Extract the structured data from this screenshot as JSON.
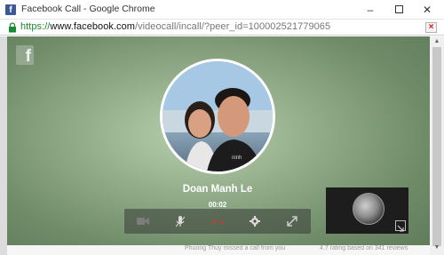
{
  "window": {
    "title": "Facebook Call - Google Chrome",
    "favicon": "f",
    "minimize_label": "–",
    "close_label": "✕"
  },
  "address_bar": {
    "protocol": "https://",
    "host": "www.facebook.com",
    "path": "/videocall/incall/?peer_id=100002521779065",
    "action_icon": "blocked-popup-icon"
  },
  "call": {
    "logo_text": "f",
    "caller_name": "Doan Manh Le",
    "duration": "00:02",
    "controls": [
      {
        "name": "camera-toggle",
        "icon": "video-camera-icon",
        "enabled": false
      },
      {
        "name": "mute-toggle",
        "icon": "microphone-icon"
      },
      {
        "name": "end-call",
        "icon": "hang-up-icon",
        "color": "#d33a2c"
      },
      {
        "name": "settings",
        "icon": "gear-icon"
      },
      {
        "name": "fullscreen",
        "icon": "expand-icon"
      }
    ]
  },
  "underlying_page": {
    "snippet_left": "Phuong Thuy missed a call from you",
    "snippet_right": "4.7 rating based on 341 reviews"
  },
  "colors": {
    "accent": "#3b5998",
    "https_green": "#1a8a2e",
    "hangup_red": "#d33a2c"
  }
}
